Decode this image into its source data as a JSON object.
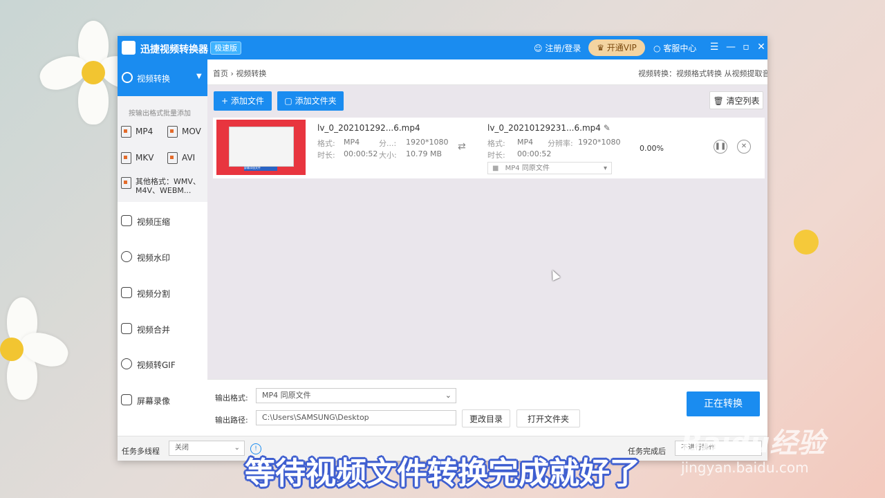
{
  "app": {
    "name": "迅捷视频转换器",
    "badge": "极速版"
  },
  "titlebar": {
    "login": "注册/登录",
    "vip": "开通VIP",
    "service": "客服中心",
    "menu_icon": "menu-icon",
    "min_icon": "minimize-icon",
    "max_icon": "maximize-icon",
    "close_icon": "close-icon"
  },
  "sidebar": {
    "active": "视频转换",
    "hint": "按输出格式批量添加",
    "formats": [
      "MP4",
      "MOV",
      "MKV",
      "AVI"
    ],
    "other": "其他格式：WMV、M4V、WEBM...",
    "items": [
      "视频压缩",
      "视频水印",
      "视频分割",
      "视频合并",
      "视频转GIF",
      "屏幕录像"
    ]
  },
  "breadcrumb": {
    "home": "首页",
    "sep": "›",
    "current": "视频转换"
  },
  "description": "视频转换：视频格式转换 从视频提取音频",
  "toolbar": {
    "add_file": "添加文件",
    "add_folder": "添加文件夹",
    "clear": "清空列表"
  },
  "file": {
    "src_name": "lv_0_202101292...6.mp4",
    "fmt_label": "格式:",
    "fmt_value": "MP4",
    "res_label": "分...:",
    "res_value": "1920*1080",
    "dur_label": "时长:",
    "dur_value": "00:00:52",
    "size_label": "大小:",
    "size_value": "10.79 MB",
    "out_name": "lv_0_20210129231...6.mp4",
    "out_fmt_label": "格式:",
    "out_fmt_value": "MP4",
    "out_res_label": "分辨率:",
    "out_res_value": "1920*1080",
    "out_dur_label": "时长:",
    "out_dur_value": "00:00:52",
    "out_select": "MP4  同原文件",
    "progress": "0.00%",
    "thumb_text": "屏幕添加文件"
  },
  "bottom": {
    "format_label": "输出格式:",
    "format_value": "MP4  同原文件",
    "path_label": "输出路径:",
    "path_value": "C:\\Users\\SAMSUNG\\Desktop",
    "change_dir": "更改目录",
    "open_folder": "打开文件夹",
    "start": "正在转换"
  },
  "statusbar": {
    "thread_label": "任务多线程",
    "thread_value": "关闭",
    "after_label": "任务完成后",
    "after_value": "不进行操作"
  },
  "caption": "等待视频文件转换完成就好了",
  "watermark": {
    "brand": "Baidu经验",
    "url": "jingyan.baidu.com"
  }
}
